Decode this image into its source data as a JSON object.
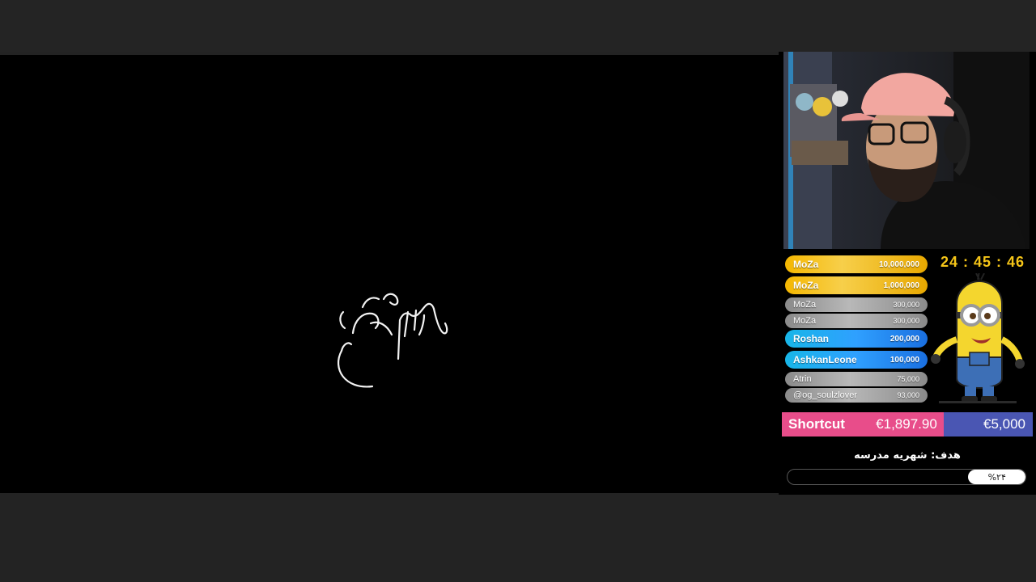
{
  "timer": "24 : 45 : 46",
  "leaderboard": [
    {
      "name": "MoZa",
      "amount": "10,000,000",
      "tier": "gold"
    },
    {
      "name": "MoZa",
      "amount": "1,000,000",
      "tier": "gold"
    },
    {
      "name": "MoZa",
      "amount": "300,000",
      "tier": "silver"
    },
    {
      "name": "MoZa",
      "amount": "300,000",
      "tier": "silver"
    },
    {
      "name": "Roshan",
      "amount": "200,000",
      "tier": "blue"
    },
    {
      "name": "AshkanLeone",
      "amount": "100,000",
      "tier": "blue"
    },
    {
      "name": "Atrin",
      "amount": "75,000",
      "tier": "silver"
    },
    {
      "name": "@og_soulzlover",
      "amount": "93,000",
      "tier": "silver"
    }
  ],
  "donation_goal": {
    "label": "Shortcut",
    "raised": "€1,897.90",
    "target": "€5,000"
  },
  "target": {
    "title": "هدف: شهریه مدرسه",
    "percent_label": "%۲۴",
    "progress": 0.24
  },
  "colors": {
    "accent_pink": "#e84d8a",
    "accent_blue": "#4a56b3",
    "timer": "#f5c518"
  }
}
